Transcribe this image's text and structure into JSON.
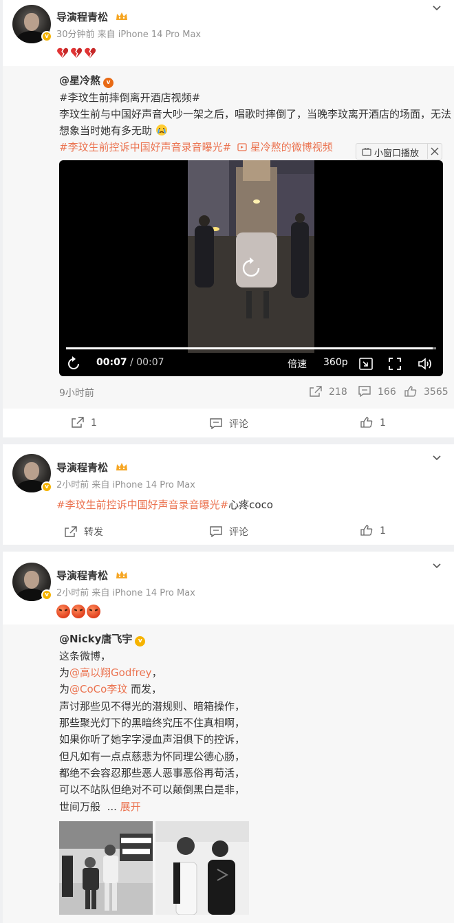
{
  "post1": {
    "author": "导演程青松",
    "meta": "30分钟前 来自 iPhone 14 Pro Max",
    "emojis": [
      "broken-heart-icon",
      "broken-heart-icon",
      "broken-heart-icon"
    ],
    "repost": {
      "author": "@星冷熬",
      "line1_tag": "#李玟生前摔倒离开酒店视频#",
      "line2": "李玟生前与中国好声音大吵一架之后，唱歌时摔倒了，当晚李玟离开酒店的场面，无法",
      "line3": "想象当时她有多无助",
      "line4_tag": "#李玟生前控诉中国好声音录音曝光#",
      "line4_link": "星冷熬的微博视频",
      "mini_window": "小窗口播放",
      "video": {
        "current": "00:07",
        "separator": "/",
        "duration": "00:07",
        "speed": "倍速",
        "quality": "360p",
        "progress_fraction": 0.99
      },
      "time": "9小时前",
      "repost_count": "218",
      "comment_count": "166",
      "like_count": "3565"
    },
    "actions": {
      "repost": "1",
      "comment": "评论",
      "like": "1"
    }
  },
  "post2": {
    "author": "导演程青松",
    "meta": "2小时前 来自 iPhone 14 Pro Max",
    "tag": "#李玟生前控诉中国好声音录音曝光#",
    "text": "心疼coco",
    "actions": {
      "repost": "转发",
      "comment": "评论",
      "like": "1"
    }
  },
  "post3": {
    "author": "导演程青松",
    "meta": "2小时前 来自 iPhone 14 Pro Max",
    "emojis": [
      "angry-face-icon",
      "angry-face-icon",
      "angry-face-icon"
    ],
    "repost": {
      "author": "@Nicky唐飞宇",
      "l1": "这条微博，",
      "l2_pre": "为",
      "l2_link": "@高以翔Godfrey",
      "l2_post": "，",
      "l3_pre": "为",
      "l3_link": "@CoCo李玟",
      "l3_post": " 而发，",
      "l4": "声讨那些见不得光的潜规则、暗箱操作，",
      "l5": "那些聚光灯下的黑暗终究压不住真相啊，",
      "l6": "如果你听了她字字浸血声泪俱下的控诉，",
      "l7": "但凡如有一点点慈悲为怀同理公德心肠，",
      "l8": "都绝不会容忍那些恶人恶事恶俗再苟活，",
      "l9": "可以不站队但绝对不可以颠倒黑白是非，",
      "l10": "世间万般",
      "l10_ellipsis": "...",
      "expand": "展开"
    }
  }
}
